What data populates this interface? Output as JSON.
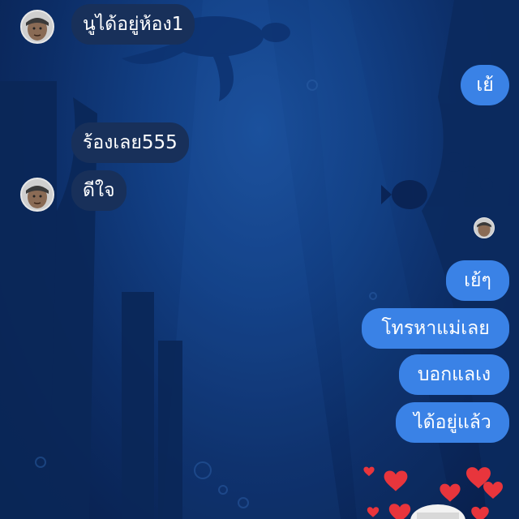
{
  "chat": {
    "messages": [
      {
        "sender": "other",
        "text": "นูได้อยู่ห้อง1"
      },
      {
        "sender": "me",
        "text": "เย้"
      },
      {
        "sender": "other",
        "text": "ร้องเลย555"
      },
      {
        "sender": "other",
        "text": "ดีใจ"
      },
      {
        "sender": "me",
        "text": "เย้ๆ"
      },
      {
        "sender": "me",
        "text": "โทรหาแม่เลย"
      },
      {
        "sender": "me",
        "text": "บอกแลเง"
      },
      {
        "sender": "me",
        "text": "ได้อยู่แล้ว"
      }
    ]
  },
  "colors": {
    "background": "#123f84",
    "incoming_bubble": "#18305a",
    "outgoing_bubble": "#3a82e6",
    "text": "#ffffff",
    "heart": "#e8353c"
  },
  "icons": {
    "avatar": "contact-avatar",
    "read_receipt": "read-receipt-avatar",
    "reaction": "heart-icon"
  }
}
